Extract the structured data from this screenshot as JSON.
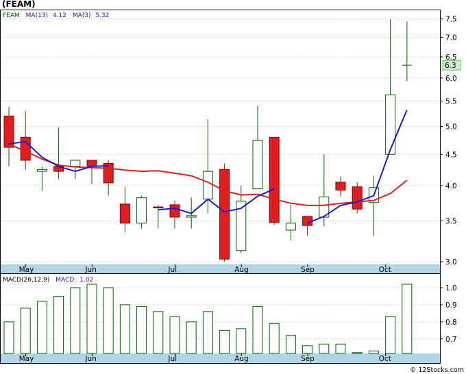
{
  "title": "(FEAM)",
  "copyright": "© 12Stocks.com",
  "colors": {
    "up_fill": "#ffffff",
    "up_border": "#006400",
    "down_fill": "#e51c1c",
    "down_border": "#8b0000",
    "wick": "#006400",
    "ma13": "#e51c1c",
    "ma3": "#1a1ad6",
    "axis_band": "#b0d4e8",
    "last_price_box": "#c8f0c8",
    "macd_bar": "#006400"
  },
  "chart_data": [
    {
      "type": "candlestick",
      "legend": [
        {
          "name": "FEAM",
          "value": "",
          "color": "#006400"
        },
        {
          "name": "MA(13)",
          "value": "4.12",
          "color": "#e51c1c"
        },
        {
          "name": "MA(3)",
          "value": "5.32",
          "color": "#1a1ad6"
        }
      ],
      "y_scale": "log",
      "ylim": [
        2.97,
        7.75
      ],
      "yticks": [
        3.0,
        3.5,
        4.0,
        4.5,
        5.0,
        5.5,
        6.0,
        6.5,
        7.0,
        7.5
      ],
      "ytick_labels": [
        "3.0",
        "3.5",
        "4.0",
        "4.5",
        "5.0",
        "5.5",
        "6.0",
        "6.5",
        "7.0",
        "7.5"
      ],
      "last_price": 6.3,
      "last_price_label": "6.3",
      "x_labels": [
        {
          "label": "May",
          "index": 1.1
        },
        {
          "label": "Jun",
          "index": 5.1
        },
        {
          "label": "Jul",
          "index": 10.1
        },
        {
          "label": "Aug",
          "index": 14.1
        },
        {
          "label": "Sep",
          "index": 18.1
        },
        {
          "label": "Oct",
          "index": 22.8
        }
      ],
      "candles": [
        {
          "open": 5.2,
          "high": 5.38,
          "low": 4.3,
          "close": 4.62
        },
        {
          "open": 4.8,
          "high": 5.3,
          "low": 4.25,
          "close": 4.4
        },
        {
          "open": 4.22,
          "high": 4.3,
          "low": 3.92,
          "close": 4.25
        },
        {
          "open": 4.3,
          "high": 4.98,
          "low": 4.1,
          "close": 4.22
        },
        {
          "open": 4.3,
          "high": 4.4,
          "low": 4.1,
          "close": 4.4
        },
        {
          "open": 4.4,
          "high": 4.4,
          "low": 4.02,
          "close": 4.3
        },
        {
          "open": 4.35,
          "high": 4.4,
          "low": 3.85,
          "close": 4.04
        },
        {
          "open": 3.73,
          "high": 3.98,
          "low": 3.35,
          "close": 3.47
        },
        {
          "open": 3.47,
          "high": 3.85,
          "low": 3.4,
          "close": 3.82
        },
        {
          "open": 3.69,
          "high": 3.72,
          "low": 3.4,
          "close": 3.68
        },
        {
          "open": 3.72,
          "high": 3.78,
          "low": 3.4,
          "close": 3.55
        },
        {
          "open": 3.55,
          "high": 3.82,
          "low": 3.4,
          "close": 3.57
        },
        {
          "open": 3.8,
          "high": 5.14,
          "low": 3.6,
          "close": 4.22
        },
        {
          "open": 4.25,
          "high": 4.35,
          "low": 3.0,
          "close": 3.03
        },
        {
          "open": 3.13,
          "high": 4.0,
          "low": 3.1,
          "close": 3.77
        },
        {
          "open": 3.95,
          "high": 5.4,
          "low": 3.95,
          "close": 4.74
        },
        {
          "open": 4.8,
          "high": 4.8,
          "low": 3.45,
          "close": 3.48
        },
        {
          "open": 3.38,
          "high": 3.72,
          "low": 3.25,
          "close": 3.47
        },
        {
          "open": 3.56,
          "high": 3.56,
          "low": 3.31,
          "close": 3.44
        },
        {
          "open": 3.55,
          "high": 4.5,
          "low": 3.43,
          "close": 3.83
        },
        {
          "open": 4.05,
          "high": 4.14,
          "low": 3.84,
          "close": 3.93
        },
        {
          "open": 3.98,
          "high": 4.05,
          "low": 3.6,
          "close": 3.66
        },
        {
          "open": 3.75,
          "high": 4.15,
          "low": 3.31,
          "close": 3.97
        },
        {
          "open": 4.5,
          "high": 7.49,
          "low": 4.5,
          "close": 5.63
        },
        {
          "open": 6.3,
          "high": 7.43,
          "low": 5.93,
          "close": 6.3
        }
      ],
      "ma13": [
        [
          0,
          4.68
        ],
        [
          1,
          4.55
        ],
        [
          2,
          4.42
        ],
        [
          3,
          4.32
        ],
        [
          4,
          4.29
        ],
        [
          5,
          4.28
        ],
        [
          6,
          4.27
        ],
        [
          7,
          4.24
        ],
        [
          8,
          4.22
        ],
        [
          9,
          4.23
        ],
        [
          10,
          4.19
        ],
        [
          11,
          4.15
        ],
        [
          12,
          4.05
        ],
        [
          13,
          3.92
        ],
        [
          14,
          3.86
        ],
        [
          15,
          3.87
        ],
        [
          16,
          3.8
        ],
        [
          17,
          3.74
        ],
        [
          18,
          3.71
        ],
        [
          19,
          3.71
        ],
        [
          20,
          3.74
        ],
        [
          21,
          3.76
        ],
        [
          22,
          3.78
        ],
        [
          23,
          3.88
        ],
        [
          24,
          4.08
        ]
      ],
      "ma3": [
        [
          0,
          4.68
        ],
        [
          1,
          4.72
        ],
        [
          2,
          4.45
        ],
        [
          3,
          4.3
        ],
        [
          4,
          4.22
        ],
        [
          5,
          4.3
        ],
        [
          6,
          4.31
        ],
        [
          9,
          3.65
        ],
        [
          10,
          3.67
        ],
        [
          11,
          3.6
        ],
        [
          12,
          3.8
        ],
        [
          13,
          3.62
        ],
        [
          14,
          3.67
        ],
        [
          15,
          3.84
        ],
        [
          16,
          3.95
        ],
        [
          18,
          3.47
        ],
        [
          19,
          3.56
        ],
        [
          20,
          3.71
        ],
        [
          21,
          3.76
        ],
        [
          22,
          3.85
        ],
        [
          23,
          4.58
        ],
        [
          24,
          5.32
        ]
      ]
    },
    {
      "type": "bar",
      "legend": [
        {
          "name": "MACD(26,12,9)",
          "value": "",
          "color": "#000000"
        },
        {
          "name": "MACD:",
          "value": "1.02",
          "color": "#1a1ad6"
        }
      ],
      "ylim": [
        0.615,
        1.08
      ],
      "yticks": [
        0.7,
        0.8,
        0.9,
        1.0
      ],
      "ytick_labels": [
        "0.7",
        "0.8",
        "0.9",
        "1.0"
      ],
      "values": [
        0.8,
        0.88,
        0.92,
        0.95,
        1.0,
        1.02,
        1.0,
        0.9,
        0.89,
        0.86,
        0.83,
        0.8,
        0.86,
        0.75,
        0.76,
        0.89,
        0.79,
        0.72,
        0.66,
        0.67,
        0.67,
        0.62,
        0.63,
        0.83,
        1.02
      ],
      "x_labels": [
        {
          "label": "May",
          "index": 1.1
        },
        {
          "label": "Jun",
          "index": 5.1
        },
        {
          "label": "Jul",
          "index": 10.1
        },
        {
          "label": "Aug",
          "index": 14.1
        },
        {
          "label": "Sep",
          "index": 18.1
        },
        {
          "label": "Oct",
          "index": 22.8
        }
      ]
    }
  ]
}
